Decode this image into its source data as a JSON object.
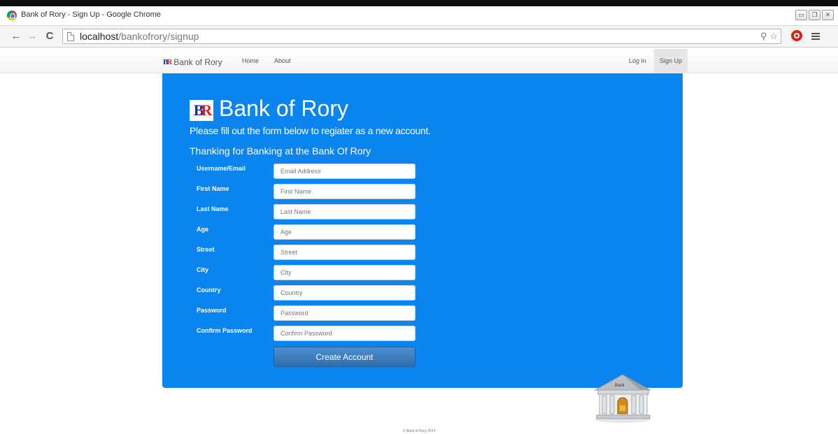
{
  "browser": {
    "window_title": "Bank of Rory - Sign Up - Google Chrome",
    "url_host": "localhost",
    "url_path": "/bankofrory/signup"
  },
  "nav": {
    "brand": "Bank of Rory",
    "logo_text_b1": "B",
    "logo_text_b2": "R",
    "links": [
      "Home",
      "About"
    ],
    "login": "Log in",
    "signup": "Sign Up"
  },
  "hero": {
    "title": "Bank of Rory",
    "intro": "Please fill out the form below to regiater as a new account.",
    "thanks": "Thanking for Banking at the Bank Of Rory"
  },
  "form": {
    "fields": [
      {
        "label": "Username/Email",
        "placeholder": "Email Address"
      },
      {
        "label": "First Name",
        "placeholder": "First Name"
      },
      {
        "label": "Last Name",
        "placeholder": "Last Name"
      },
      {
        "label": "Age",
        "placeholder": "Age"
      },
      {
        "label": "Street",
        "placeholder": "Street"
      },
      {
        "label": "City",
        "placeholder": "City"
      },
      {
        "label": "Country",
        "placeholder": "Country"
      },
      {
        "label": "Password",
        "placeholder": "Password"
      },
      {
        "label": "Confirm Password",
        "placeholder": "Confirm Password"
      }
    ],
    "submit": "Create Account"
  },
  "illustration": {
    "bank_sign": "Bank"
  },
  "footer": "© Bank of Rory 2014",
  "colors": {
    "hero_bg": "#0a85f0",
    "button": "#3a7abd"
  }
}
